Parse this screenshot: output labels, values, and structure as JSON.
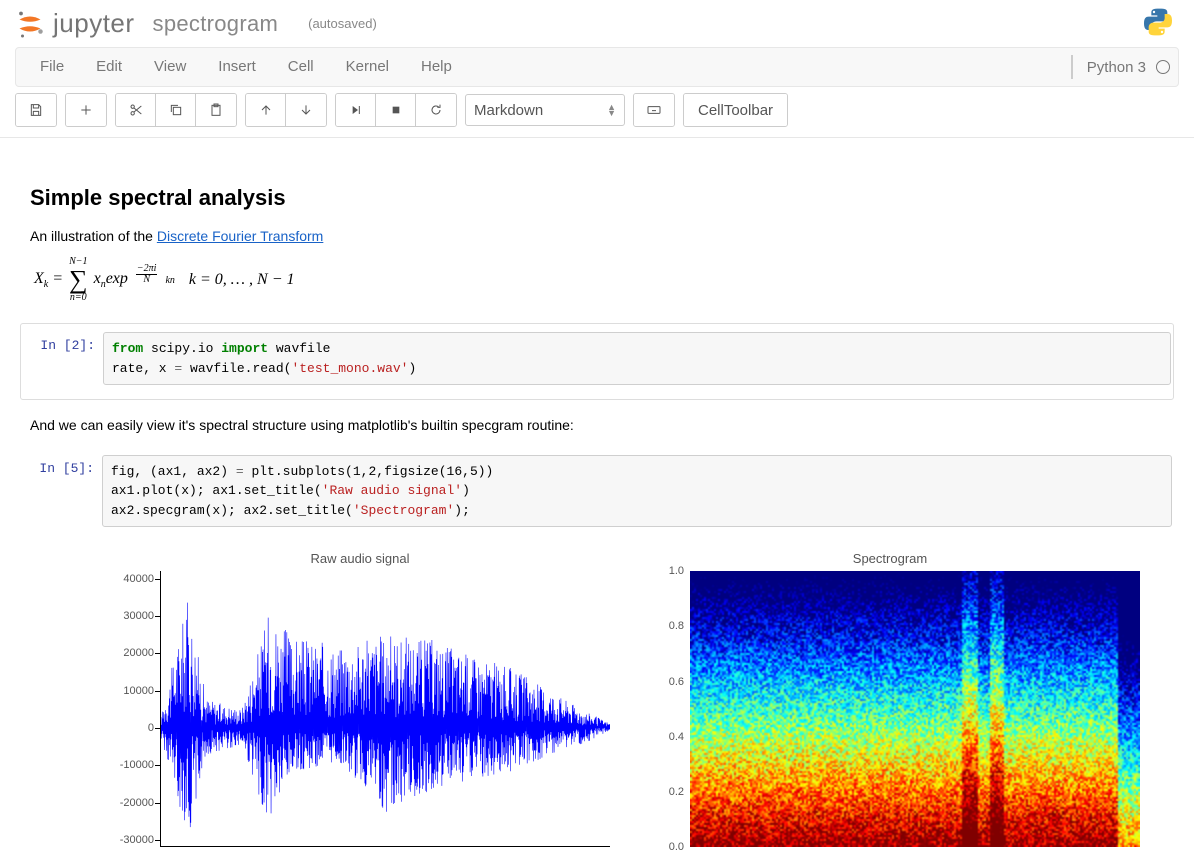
{
  "header": {
    "app_name": "jupyter",
    "notebook_name": "spectrogram",
    "autosave_status": "(autosaved)",
    "kernel_name": "Python 3",
    "kernel_logo": "python"
  },
  "menubar": {
    "items": [
      "File",
      "Edit",
      "View",
      "Insert",
      "Cell",
      "Kernel",
      "Help"
    ]
  },
  "toolbar": {
    "cell_type_selected": "Markdown",
    "cell_toolbar_label": "CellToolbar"
  },
  "notebook": {
    "title": "Simple spectral analysis",
    "intro_text_a": "An illustration of the ",
    "intro_link_text": "Discrete Fourier Transform",
    "equation_text": "X_k = \\sum_{n=0}^{N-1} x_n exp^{\\frac{-2\\pi i}{N} k n}   k = 0, ..., N-1",
    "cells": [
      {
        "prompt": "In [2]:",
        "code_lines": [
          [
            {
              "t": "from ",
              "c": "k-green"
            },
            {
              "t": "scipy.io ",
              "c": "k-black"
            },
            {
              "t": "import ",
              "c": "k-green"
            },
            {
              "t": "wavfile",
              "c": "k-black"
            }
          ],
          [
            {
              "t": "rate, x ",
              "c": "k-black"
            },
            {
              "t": "= ",
              "c": "k-purple"
            },
            {
              "t": "wavfile.read(",
              "c": "k-black"
            },
            {
              "t": "'test_mono.wav'",
              "c": "k-red"
            },
            {
              "t": ")",
              "c": "k-black"
            }
          ]
        ]
      }
    ],
    "mid_text": "And we can easily view it's spectral structure using matplotlib's builtin specgram routine:",
    "cell2": {
      "prompt": "In [5]:",
      "code_lines": [
        [
          {
            "t": "fig, (ax1, ax2) ",
            "c": "k-black"
          },
          {
            "t": "= ",
            "c": "k-purple"
          },
          {
            "t": "plt.subplots(",
            "c": "k-black"
          },
          {
            "t": "1",
            "c": "k-black"
          },
          {
            "t": ",",
            "c": "k-black"
          },
          {
            "t": "2",
            "c": "k-black"
          },
          {
            "t": ",figsize(",
            "c": "k-black"
          },
          {
            "t": "16",
            "c": "k-black"
          },
          {
            "t": ",",
            "c": "k-black"
          },
          {
            "t": "5",
            "c": "k-black"
          },
          {
            "t": "))",
            "c": "k-black"
          }
        ],
        [
          {
            "t": "ax1.plot(x); ax1.set_title(",
            "c": "k-black"
          },
          {
            "t": "'Raw audio signal'",
            "c": "k-red"
          },
          {
            "t": ")",
            "c": "k-black"
          }
        ],
        [
          {
            "t": "ax2.specgram(x); ax2.set_title(",
            "c": "k-black"
          },
          {
            "t": "'Spectrogram'",
            "c": "k-red"
          },
          {
            "t": ");",
            "c": "k-black"
          }
        ]
      ]
    }
  },
  "chart_data": [
    {
      "type": "line",
      "title": "Raw audio signal",
      "xlabel": "",
      "ylabel": "",
      "ylim": [
        -32000,
        42000
      ],
      "yticks": [
        -30000,
        -20000,
        -10000,
        0,
        10000,
        20000,
        30000,
        40000
      ],
      "description": "blue dense waveform amplitude envelope",
      "envelope_x": [
        0.0,
        0.06,
        0.1,
        0.14,
        0.18,
        0.24,
        0.3,
        0.4,
        0.5,
        0.6,
        0.68,
        0.78,
        0.88,
        0.95,
        1.0
      ],
      "envelope_hi": [
        3000,
        35000,
        8000,
        6000,
        5000,
        31000,
        24000,
        22000,
        25000,
        24000,
        20000,
        16000,
        9000,
        4000,
        1000
      ],
      "envelope_lo": [
        -3000,
        -30000,
        -8000,
        -6000,
        -5000,
        -27000,
        -12000,
        -10000,
        -23000,
        -17000,
        -15000,
        -12000,
        -7000,
        -4000,
        -1000
      ]
    },
    {
      "type": "heatmap",
      "title": "Spectrogram",
      "xlabel": "",
      "ylabel": "",
      "ylim": [
        0,
        1.0
      ],
      "yticks": [
        0.0,
        0.2,
        0.4,
        0.6,
        0.8,
        1.0
      ],
      "description": "jet-colormap spectrogram: low freqs red/orange, mid yellow/green, upper cyan/blue"
    }
  ]
}
